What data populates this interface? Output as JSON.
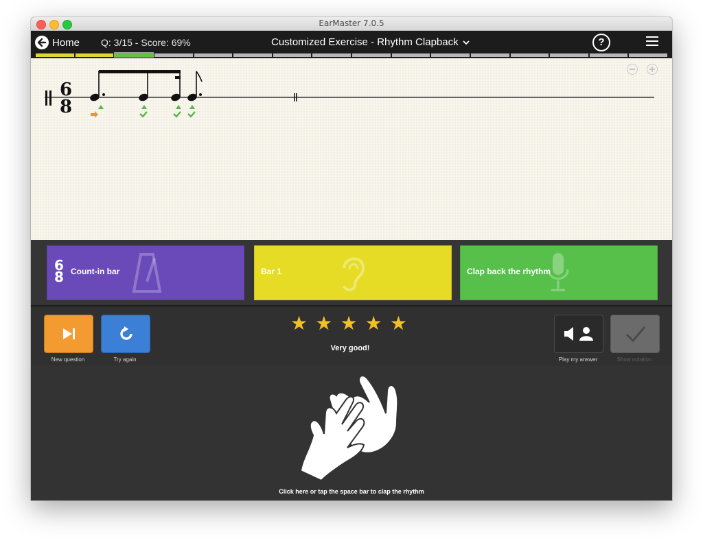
{
  "window": {
    "title": "EarMaster 7.0.5"
  },
  "topbar": {
    "home_label": "Home",
    "score_text": "Q: 3/15 - Score: 69%",
    "exercise_title": "Customized Exercise - Rhythm Clapback",
    "help_label": "?",
    "progress": {
      "total_segments": 16,
      "current_index": 2,
      "colors": {
        "completed": "#e1d631",
        "current": "#64c043",
        "pending": "#b7b7b7"
      }
    }
  },
  "notation": {
    "time_signature": {
      "top": "6",
      "bottom": "8"
    }
  },
  "panels": {
    "count_in": {
      "ts_top": "6",
      "ts_bottom": "8",
      "label": "Count-in bar",
      "icon": "metronome-icon",
      "color": "#6a4ab8"
    },
    "bar1": {
      "label": "Bar 1",
      "icon": "ear-icon",
      "color": "#e6dc26"
    },
    "clap": {
      "label": "Clap back the rhythm",
      "icon": "microphone-icon",
      "color": "#56c04a"
    }
  },
  "controls": {
    "new_question": {
      "label": "New question",
      "color": "#f39a30"
    },
    "try_again": {
      "label": "Try again",
      "color": "#3b7fd6"
    },
    "stars_count": 5,
    "verdict": "Very good!",
    "play_my_answer": {
      "label": "Play my answer"
    },
    "show_notation": {
      "label": "Show notation"
    }
  },
  "clap": {
    "instruction": "Click here or tap the space bar to clap the rhythm"
  }
}
